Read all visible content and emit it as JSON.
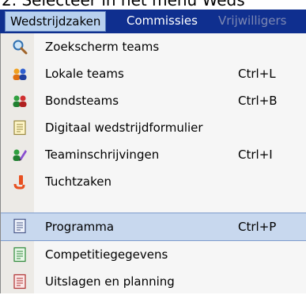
{
  "top_text": "2.  Selecteer in het menu Weds",
  "menubar": {
    "items": [
      {
        "label": "Wedstrijdzaken",
        "state": "active"
      },
      {
        "label": "Commissies",
        "state": "normal"
      },
      {
        "label": "Vrijwilligers",
        "state": "disabled"
      }
    ]
  },
  "menu": {
    "items": [
      {
        "label": "Zoekscherm teams",
        "shortcut": "",
        "icon": "search-icon"
      },
      {
        "label": "Lokale teams",
        "shortcut": "Ctrl+L",
        "icon": "local-teams-icon"
      },
      {
        "label": "Bondsteams",
        "shortcut": "Ctrl+B",
        "icon": "federation-teams-icon"
      },
      {
        "label": "Digitaal wedstrijdformulier",
        "shortcut": "",
        "icon": "digital-form-icon"
      },
      {
        "label": "Teaminschrijvingen",
        "shortcut": "Ctrl+I",
        "icon": "team-registration-icon"
      },
      {
        "label": "Tuchtzaken",
        "shortcut": "",
        "icon": "disciplinary-icon"
      },
      {
        "label": "Programma",
        "shortcut": "Ctrl+P",
        "icon": "program-icon",
        "highlighted": true
      },
      {
        "label": "Competitiegegevens",
        "shortcut": "",
        "icon": "competition-data-icon"
      },
      {
        "label": "Uitslagen en planning",
        "shortcut": "",
        "icon": "results-planning-icon"
      }
    ]
  },
  "colors": {
    "menubar_bg": "#0f2f8f",
    "highlight_bg": "#c8d8ee"
  }
}
